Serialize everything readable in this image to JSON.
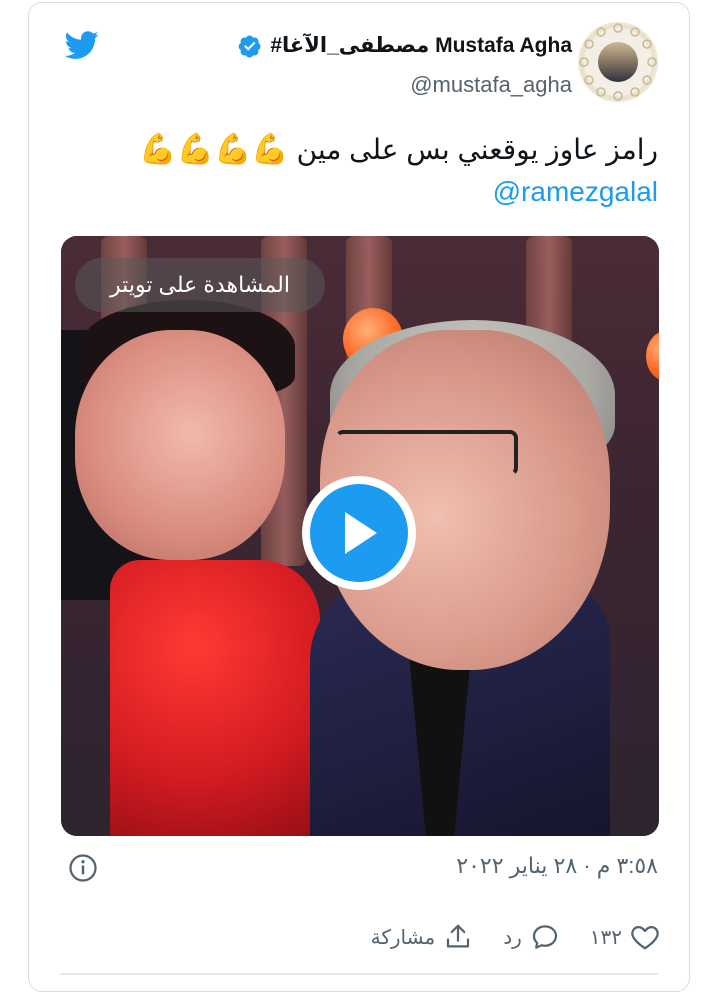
{
  "brand": {
    "accent": "#1d9bf0",
    "text_primary": "#0f1419",
    "text_secondary": "#536471",
    "icon": "twitter-bird-icon"
  },
  "author": {
    "display_name": "#مصطفى_الآغا Mustafa Agha",
    "handle": "@mustafa_agha",
    "verified_icon": "verified-badge-icon"
  },
  "tweet": {
    "text": "رامز عاوز يوقعني بس على مين",
    "emoji": "💪💪💪💪",
    "mention": "@ramezgalal"
  },
  "media": {
    "watch_label": "المشاهدة على تويتر",
    "play_icon": "play-icon"
  },
  "meta": {
    "timestamp": "٣:٥٨ م · ٢٨ يناير ٢٠٢٢",
    "info_icon": "info-icon"
  },
  "actions": {
    "like_count": "١٣٢",
    "reply_label": "رد",
    "share_label": "مشاركة"
  }
}
